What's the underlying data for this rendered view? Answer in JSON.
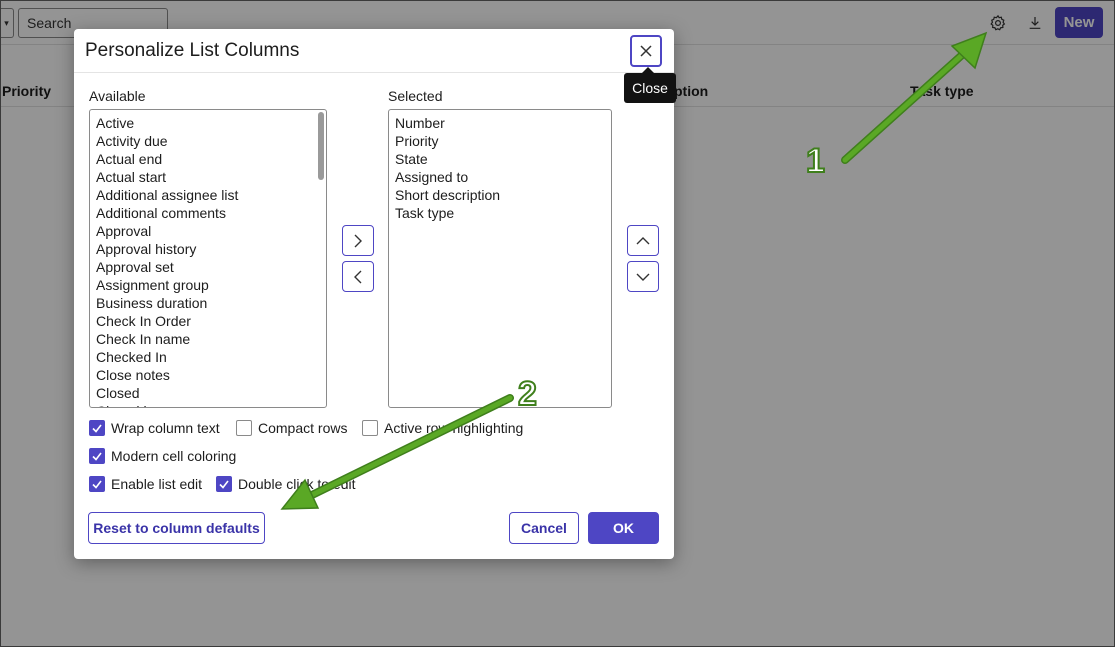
{
  "topbar": {
    "search_placeholder": "Search",
    "new_label": "New"
  },
  "table_headers": {
    "priority": "Priority",
    "description_fragment": "ption",
    "task_type_fragment": "Task type"
  },
  "modal": {
    "title": "Personalize List Columns",
    "close_tooltip": "Close",
    "available_label": "Available",
    "selected_label": "Selected",
    "available_items": [
      "Active",
      "Activity due",
      "Actual end",
      "Actual start",
      "Additional assignee list",
      "Additional comments",
      "Approval",
      "Approval history",
      "Approval set",
      "Assignment group",
      "Business duration",
      "Check In Order",
      "Check In name",
      "Checked In",
      "Close notes",
      "Closed",
      "Closed by"
    ],
    "selected_items": [
      "Number",
      "Priority",
      "State",
      "Assigned to",
      "Short description",
      "Task type"
    ],
    "options": {
      "wrap_column_text": {
        "label": "Wrap column text",
        "checked": true
      },
      "compact_rows": {
        "label": "Compact rows",
        "checked": false
      },
      "active_row_highlighting": {
        "label": "Active row highlighting",
        "checked": false
      },
      "modern_cell_coloring": {
        "label": "Modern cell coloring",
        "checked": true
      },
      "enable_list_edit": {
        "label": "Enable list edit",
        "checked": true
      },
      "double_click_to_edit": {
        "label": "Double click to edit",
        "checked": true
      }
    },
    "reset_label": "Reset to column defaults",
    "cancel_label": "Cancel",
    "ok_label": "OK"
  },
  "annotations": {
    "marker_1": "1",
    "marker_2": "2",
    "arrow_color": "#5aa825"
  },
  "colors": {
    "accent": "#4e46c4",
    "overlay": "rgba(0,0,0,0.42)"
  },
  "icons": {
    "close": "close-icon",
    "settings": "gear-icon",
    "download": "download-icon",
    "move_right": "chevron-right-icon",
    "move_left": "chevron-left-icon",
    "move_up": "chevron-up-icon",
    "move_down": "chevron-down-icon"
  }
}
